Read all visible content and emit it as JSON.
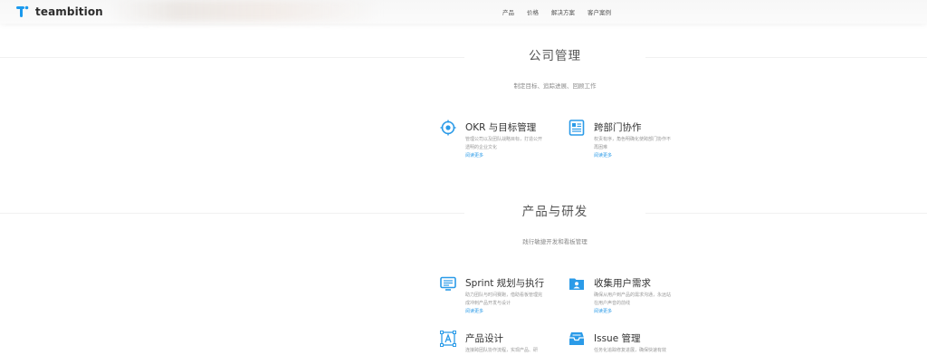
{
  "header": {
    "brand": "teambition",
    "nav": [
      "产品",
      "价格",
      "解决方案",
      "客户案例"
    ]
  },
  "colors": {
    "accent": "#2b9be8",
    "text": "#333333",
    "muted": "#999999"
  },
  "sections": [
    {
      "title": "公司管理",
      "subtitle": "制定目标、追踪进展、回顾工作",
      "features": [
        {
          "icon": "target-icon",
          "title": "OKR 与目标管理",
          "desc": "管理公司以及团队战略目标，打造公开透明的企业文化",
          "link": "阅读更多"
        },
        {
          "icon": "document-icon",
          "title": "跨部门协作",
          "desc": "权责有序，角色明确化使跨部门协作不再困难",
          "link": "阅读更多"
        }
      ]
    },
    {
      "title": "产品与研发",
      "subtitle": "践行敏捷开发和看板管理",
      "features": [
        {
          "icon": "monitor-icon",
          "title": "Sprint 规划与执行",
          "desc": "助力团队与时间赛跑，借助看板管理完成冲刺产品开发与设计",
          "link": "阅读更多"
        },
        {
          "icon": "user-folder-icon",
          "title": "收集用户需求",
          "desc": "确保从用户到产品的需求沟通，永远站在用户声音的前线",
          "link": "阅读更多"
        },
        {
          "icon": "design-icon",
          "title": "产品设计",
          "desc": "连接跨团队协作流程，实现产品、研",
          "link": ""
        },
        {
          "icon": "inbox-icon",
          "title": "Issue 管理",
          "desc": "任务化追踪修复进展，确保快速有效",
          "link": ""
        }
      ]
    }
  ]
}
